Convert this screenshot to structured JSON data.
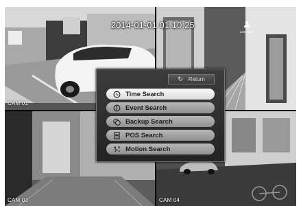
{
  "datetime": "2014-01-01 01:10:25",
  "logout_label": "LOG OUT",
  "cameras": [
    {
      "label": "CAM 01"
    },
    {
      "label": ""
    },
    {
      "label": "CAM 03"
    },
    {
      "label": "CAM 04"
    }
  ],
  "menu": {
    "return_label": "Return",
    "items": [
      {
        "label": "Time Search",
        "icon": "clock-icon",
        "active": true
      },
      {
        "label": "Event Search",
        "icon": "event-icon",
        "active": false
      },
      {
        "label": "Backup Search",
        "icon": "backup-icon",
        "active": false
      },
      {
        "label": "POS Search",
        "icon": "pos-icon",
        "active": false
      },
      {
        "label": "Motion Search",
        "icon": "motion-icon",
        "active": false
      }
    ]
  }
}
